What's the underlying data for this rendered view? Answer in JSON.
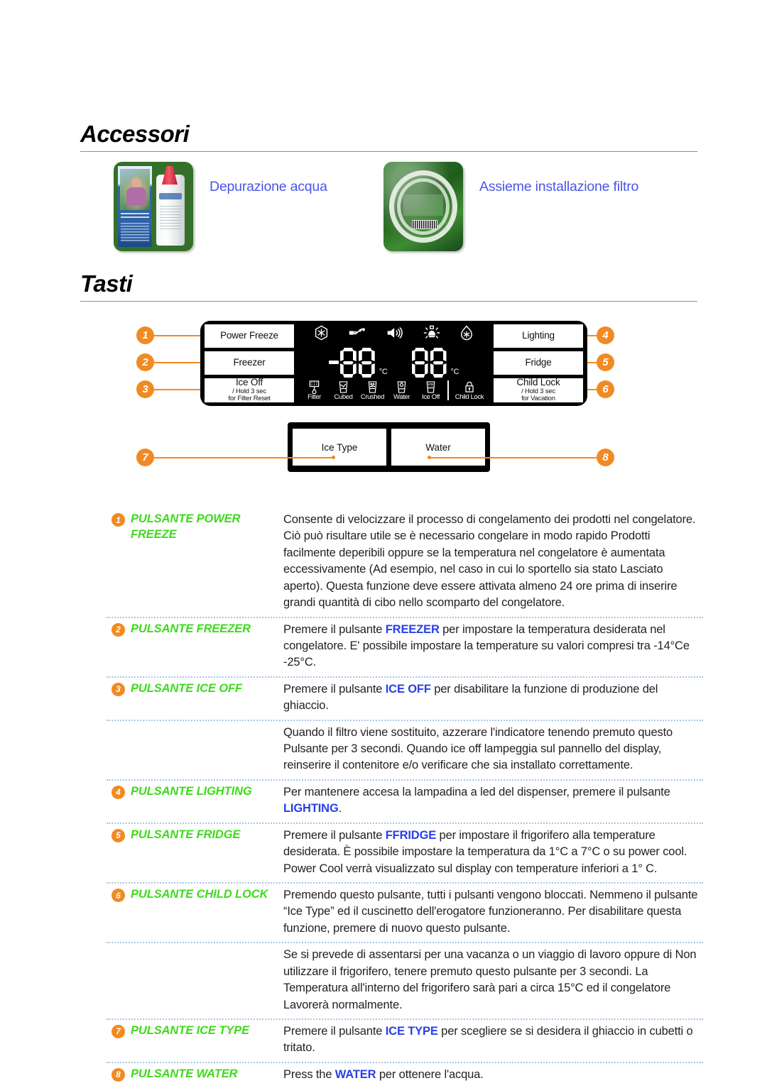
{
  "sections": {
    "accessori_title": "Accessori",
    "tasti_title": "Tasti"
  },
  "accessories": [
    {
      "label": "Depurazione acqua",
      "icon": "water-filter-photo"
    },
    {
      "label": "Assieme installazione filtro",
      "icon": "filter-install-kit-photo"
    }
  ],
  "panel": {
    "left_buttons": [
      {
        "label": "Power Freeze",
        "sub": ""
      },
      {
        "label": "Freezer",
        "sub": ""
      },
      {
        "label": "Ice Off",
        "sub": "/ Hold 3 sec\nfor Filter Reset"
      }
    ],
    "right_buttons": [
      {
        "label": "Lighting",
        "sub": ""
      },
      {
        "label": "Fridge",
        "sub": ""
      },
      {
        "label": "Child Lock",
        "sub": "/ Hold 3 sec\nfor Vacation"
      }
    ],
    "left_sub_1": "/ Hold 3 sec",
    "left_sub_2": "for Filter Reset",
    "right_sub_1": "/ Hold 3 sec",
    "right_sub_2": "for Vacation",
    "display": {
      "top_icons": [
        "power-freeze-icon",
        "vacation-icon",
        "alarm-speaker-icon",
        "lamp-icon",
        "power-cool-icon"
      ],
      "left_digit": "88",
      "left_minus": "-",
      "left_unit": "°C",
      "right_digit": "88",
      "right_unit": "°C",
      "indicators": [
        {
          "name": "Filter",
          "icon": "filter-icon"
        },
        {
          "name": "Cubed",
          "icon": "cubed-ice-icon"
        },
        {
          "name": "Crushed",
          "icon": "crushed-ice-icon"
        },
        {
          "name": "Water",
          "icon": "water-glass-icon"
        },
        {
          "name": "Ice Off",
          "icon": "ice-off-icon"
        },
        {
          "name": "Child Lock",
          "icon": "padlock-icon"
        }
      ]
    },
    "bottom_buttons": [
      {
        "label": "Ice Type"
      },
      {
        "label": "Water"
      }
    ],
    "callouts": [
      "1",
      "2",
      "3",
      "4",
      "5",
      "6",
      "7",
      "8"
    ]
  },
  "table": {
    "rows": [
      {
        "num": "1",
        "name": "PULSANTE POWER FREEZE",
        "desc_parts": [
          {
            "t": "Consente di velocizzare il processo di congelamento dei prodotti nel congelatore. Ciò può risultare utile se è necessario congelare in modo rapido Prodotti facilmente deperibili oppure se la temperatura nel congelatore è aumentata eccessivamente (Ad esempio, nel caso in cui lo sportello sia stato Lasciato aperto). Questa funzione deve essere attivata almeno 24 ore prima di inserire grandi quantità di cibo nello scomparto del congelatore.",
            "kw": false
          }
        ]
      },
      {
        "num": "2",
        "name": "PULSANTE FREEZER",
        "desc_parts": [
          {
            "t": "Premere il pulsante ",
            "kw": false
          },
          {
            "t": "FREEZER",
            "kw": true
          },
          {
            "t": " per impostare la temperatura desiderata nel congelatore. E' possibile impostare la temperature su valori compresi tra -14°Ce -25°C.",
            "kw": false
          }
        ]
      },
      {
        "num": "3",
        "name": "PULSANTE ICE OFF",
        "desc_parts": [
          {
            "t": "Premere il pulsante ",
            "kw": false
          },
          {
            "t": "ICE OFF",
            "kw": true
          },
          {
            "t": " per disabilitare la funzione di produzione del ghiaccio.",
            "kw": false
          }
        ]
      },
      {
        "num": "",
        "name": "",
        "desc_parts": [
          {
            "t": "Quando il filtro viene sostituito, azzerare l'indicatore tenendo premuto questo Pulsante per 3 secondi. Quando ice off lampeggia sul pannello del display, reinserire il contenitore e/o verificare che sia installato correttamente.",
            "kw": false
          }
        ]
      },
      {
        "num": "4",
        "name": "PULSANTE LIGHTING",
        "desc_parts": [
          {
            "t": "Per mantenere accesa la lampadina a led del dispenser, premere il pulsante ",
            "kw": false
          },
          {
            "t": "LIGHTING",
            "kw": true
          },
          {
            "t": ".",
            "kw": false
          }
        ]
      },
      {
        "num": "5",
        "name": "PULSANTE FRIDGE",
        "desc_parts": [
          {
            "t": "Premere il pulsante ",
            "kw": false
          },
          {
            "t": "FFRIDGE",
            "kw": true
          },
          {
            "t": " per impostare il frigorifero alla temperature desiderata. È possibile impostare la temperatura da 1°C a 7°C o su power cool. Power Cool verrà visualizzato sul display con temperature inferiori a 1° C.",
            "kw": false
          }
        ]
      },
      {
        "num": "6",
        "name": "PULSANTE CHILD LOCK",
        "desc_parts": [
          {
            "t": "Premendo questo pulsante, tutti i pulsanti vengono bloccati. Nemmeno il pulsante “Ice Type” ed il cuscinetto dell'erogatore funzioneranno. Per disabilitare questa funzione, premere di nuovo questo pulsante.",
            "kw": false
          }
        ]
      },
      {
        "num": "",
        "name": "",
        "desc_parts": [
          {
            "t": "Se si prevede di assentarsi per una vacanza o un viaggio di lavoro oppure di Non utilizzare il frigorifero, tenere premuto questo pulsante per 3 secondi. La Temperatura all'interno del frigorifero sarà pari a circa 15°C ed il congelatore Lavorerà normalmente.",
            "kw": false
          }
        ]
      },
      {
        "num": "7",
        "name": "PULSANTE ICE TYPE",
        "desc_parts": [
          {
            "t": "Premere il pulsante ",
            "kw": false
          },
          {
            "t": "ICE TYPE",
            "kw": true
          },
          {
            "t": " per scegliere se si desidera il ghiaccio in cubetti o tritato.",
            "kw": false
          }
        ]
      },
      {
        "num": "8",
        "name": "PULSANTE WATER",
        "desc_parts": [
          {
            "t": "Press the ",
            "kw": false
          },
          {
            "t": "WATER",
            "kw": true
          },
          {
            "t": " per ottenere l'acqua.",
            "kw": false
          }
        ]
      }
    ]
  },
  "colors": {
    "accent_orange": "#f18a21",
    "green_label": "#3ddb1b",
    "blue_keyword": "#2a3fe6",
    "blue_link": "#4a55e8",
    "divider": "#a9c6e8"
  }
}
